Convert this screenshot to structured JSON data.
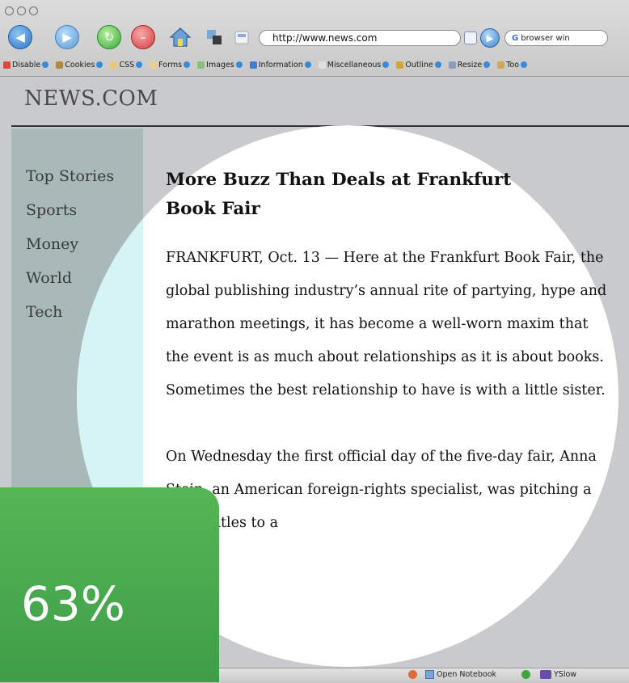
{
  "browser": {
    "url": "http://www.news.com",
    "search_query": "browser win",
    "dev_toolbar": [
      {
        "label": "Disable",
        "icon": "disable-icon",
        "color": "#d84a3a"
      },
      {
        "label": "Cookies",
        "icon": "cookie-icon",
        "color": "#b8863b"
      },
      {
        "label": "CSS",
        "icon": "css-icon",
        "color": "#e9c978"
      },
      {
        "label": "Forms",
        "icon": "forms-icon",
        "color": "#e7cf8c"
      },
      {
        "label": "Images",
        "icon": "images-icon",
        "color": "#8cc07a"
      },
      {
        "label": "Information",
        "icon": "information-icon",
        "color": "#3f7fd0"
      },
      {
        "label": "Miscellaneous",
        "icon": "miscellaneous-icon",
        "color": "#e0e0e0"
      },
      {
        "label": "Outline",
        "icon": "outline-icon",
        "color": "#d4a43c"
      },
      {
        "label": "Resize",
        "icon": "resize-icon",
        "color": "#8a9ec0"
      },
      {
        "label": "Too",
        "icon": "tools-icon",
        "color": "#cfa850"
      }
    ],
    "status_items": [
      {
        "label": "Open Notebook",
        "icon": "notebook-icon"
      },
      {
        "label": "YSlow",
        "icon": "yslow-icon"
      }
    ]
  },
  "site": {
    "title": "NEWS.COM",
    "nav": [
      "Top Stories",
      "Sports",
      "Money",
      "World",
      "Tech"
    ]
  },
  "article": {
    "headline": "More Buzz Than Deals at Frankfurt Book Fair",
    "paragraphs": [
      "FRANKFURT, Oct. 13 — Here at the Frankfurt Book Fair, the global publishing industry’s annual rite of partying, hype and marathon meetings, it has become a well-worn maxim that the event is as much about relationships as it is about books. Sometimes the best relationship to have is with a little sister.",
      "On Wednesday the first official day of the five-day fair, Anna Stein, an American foreign-rights specialist, was pitching a list of titles to a"
    ]
  },
  "badge": {
    "text": "63%",
    "color": "#4cab4f"
  }
}
